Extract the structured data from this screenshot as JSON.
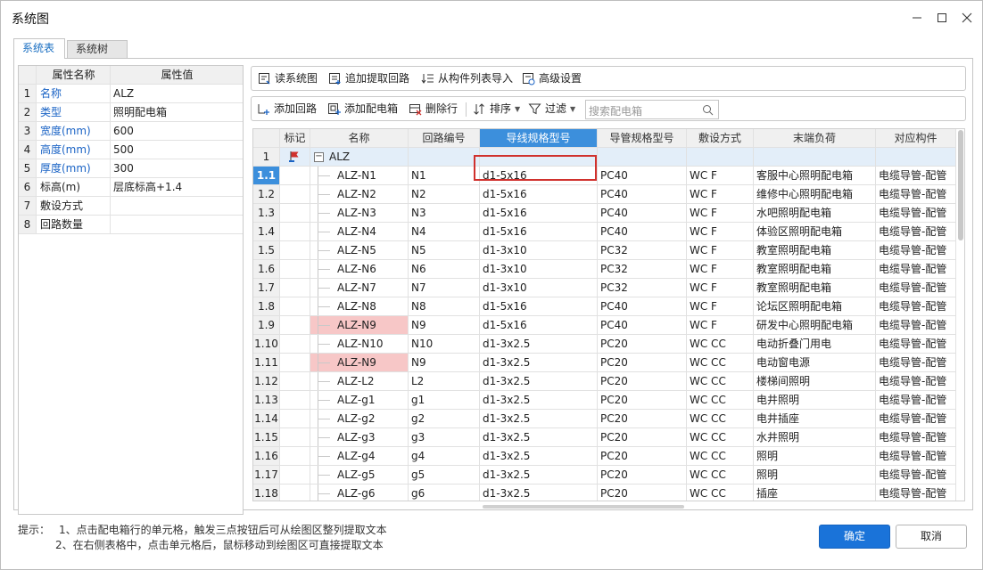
{
  "window": {
    "title": "系统图"
  },
  "tabs": [
    "系统表",
    "系统树"
  ],
  "left": {
    "headers": [
      "",
      "属性名称",
      "属性值"
    ],
    "rows": [
      {
        "n": "1",
        "name": "名称",
        "value": "ALZ",
        "blue": true
      },
      {
        "n": "2",
        "name": "类型",
        "value": "照明配电箱",
        "blue": true
      },
      {
        "n": "3",
        "name": "宽度(mm)",
        "value": "600",
        "blue": true
      },
      {
        "n": "4",
        "name": "高度(mm)",
        "value": "500",
        "blue": true
      },
      {
        "n": "5",
        "name": "厚度(mm)",
        "value": "300",
        "blue": true
      },
      {
        "n": "6",
        "name": "标高(m)",
        "value": "层底标高+1.4",
        "blue": false
      },
      {
        "n": "7",
        "name": "敷设方式",
        "value": "",
        "blue": false
      },
      {
        "n": "8",
        "name": "回路数量",
        "value": "",
        "blue": false
      }
    ]
  },
  "toolbar1": {
    "read": "读系统图",
    "append": "追加提取回路",
    "import": "从构件列表导入",
    "advanced": "高级设置"
  },
  "toolbar2": {
    "add_loop": "添加回路",
    "add_box": "添加配电箱",
    "delete_row": "删除行",
    "sort": "排序",
    "filter": "过滤",
    "search_placeholder": "搜索配电箱"
  },
  "grid": {
    "headers": [
      "",
      "标记",
      "名称",
      "回路编号",
      "导线规格型号",
      "导管规格型号",
      "敷设方式",
      "末端负荷",
      "对应构件"
    ],
    "parent": {
      "n": "1",
      "name": "ALZ"
    },
    "rows": [
      {
        "n": "1.1",
        "name": "ALZ-N1",
        "loop": "N1",
        "wire": "d1-5x16",
        "pipe": "PC40",
        "lay": "WC F",
        "load": "客服中心照明配电箱",
        "comp": "电缆导管-配管",
        "pink": false
      },
      {
        "n": "1.2",
        "name": "ALZ-N2",
        "loop": "N2",
        "wire": "d1-5x16",
        "pipe": "PC40",
        "lay": "WC F",
        "load": "维修中心照明配电箱",
        "comp": "电缆导管-配管",
        "pink": false
      },
      {
        "n": "1.3",
        "name": "ALZ-N3",
        "loop": "N3",
        "wire": "d1-5x16",
        "pipe": "PC40",
        "lay": "WC F",
        "load": "水吧照明配电箱",
        "comp": "电缆导管-配管",
        "pink": false
      },
      {
        "n": "1.4",
        "name": "ALZ-N4",
        "loop": "N4",
        "wire": "d1-5x16",
        "pipe": "PC40",
        "lay": "WC F",
        "load": "体验区照明配电箱",
        "comp": "电缆导管-配管",
        "pink": false
      },
      {
        "n": "1.5",
        "name": "ALZ-N5",
        "loop": "N5",
        "wire": "d1-3x10",
        "pipe": "PC32",
        "lay": "WC F",
        "load": "教室照明配电箱",
        "comp": "电缆导管-配管",
        "pink": false
      },
      {
        "n": "1.6",
        "name": "ALZ-N6",
        "loop": "N6",
        "wire": "d1-3x10",
        "pipe": "PC32",
        "lay": "WC F",
        "load": "教室照明配电箱",
        "comp": "电缆导管-配管",
        "pink": false
      },
      {
        "n": "1.7",
        "name": "ALZ-N7",
        "loop": "N7",
        "wire": "d1-3x10",
        "pipe": "PC32",
        "lay": "WC F",
        "load": "教室照明配电箱",
        "comp": "电缆导管-配管",
        "pink": false
      },
      {
        "n": "1.8",
        "name": "ALZ-N8",
        "loop": "N8",
        "wire": "d1-5x16",
        "pipe": "PC40",
        "lay": "WC F",
        "load": "论坛区照明配电箱",
        "comp": "电缆导管-配管",
        "pink": false
      },
      {
        "n": "1.9",
        "name": "ALZ-N9",
        "loop": "N9",
        "wire": "d1-5x16",
        "pipe": "PC40",
        "lay": "WC F",
        "load": "研发中心照明配电箱",
        "comp": "电缆导管-配管",
        "pink": true
      },
      {
        "n": "1.10",
        "name": "ALZ-N10",
        "loop": "N10",
        "wire": "d1-3x2.5",
        "pipe": "PC20",
        "lay": "WC CC",
        "load": "电动折叠门用电",
        "comp": "电缆导管-配管",
        "pink": false
      },
      {
        "n": "1.11",
        "name": "ALZ-N9",
        "loop": "N9",
        "wire": "d1-3x2.5",
        "pipe": "PC20",
        "lay": "WC CC",
        "load": "电动窗电源",
        "comp": "电缆导管-配管",
        "pink": true
      },
      {
        "n": "1.12",
        "name": "ALZ-L2",
        "loop": "L2",
        "wire": "d1-3x2.5",
        "pipe": "PC20",
        "lay": "WC CC",
        "load": "楼梯间照明",
        "comp": "电缆导管-配管",
        "pink": false
      },
      {
        "n": "1.13",
        "name": "ALZ-g1",
        "loop": "g1",
        "wire": "d1-3x2.5",
        "pipe": "PC20",
        "lay": "WC CC",
        "load": "电井照明",
        "comp": "电缆导管-配管",
        "pink": false
      },
      {
        "n": "1.14",
        "name": "ALZ-g2",
        "loop": "g2",
        "wire": "d1-3x2.5",
        "pipe": "PC20",
        "lay": "WC CC",
        "load": "电井插座",
        "comp": "电缆导管-配管",
        "pink": false
      },
      {
        "n": "1.15",
        "name": "ALZ-g3",
        "loop": "g3",
        "wire": "d1-3x2.5",
        "pipe": "PC20",
        "lay": "WC CC",
        "load": "水井照明",
        "comp": "电缆导管-配管",
        "pink": false
      },
      {
        "n": "1.16",
        "name": "ALZ-g4",
        "loop": "g4",
        "wire": "d1-3x2.5",
        "pipe": "PC20",
        "lay": "WC CC",
        "load": "照明",
        "comp": "电缆导管-配管",
        "pink": false
      },
      {
        "n": "1.17",
        "name": "ALZ-g5",
        "loop": "g5",
        "wire": "d1-3x2.5",
        "pipe": "PC20",
        "lay": "WC CC",
        "load": "照明",
        "comp": "电缆导管-配管",
        "pink": false
      },
      {
        "n": "1.18",
        "name": "ALZ-g6",
        "loop": "g6",
        "wire": "d1-3x2.5",
        "pipe": "PC20",
        "lay": "WC CC",
        "load": "插座",
        "comp": "电缆导管-配管",
        "pink": false
      }
    ]
  },
  "hint": {
    "label": "提示：",
    "line1": "1、点击配电箱行的单元格，触发三点按钮后可从绘图区整列提取文本",
    "line2": "2、在右侧表格中，点击单元格后，鼠标移动到绘图区可直接提取文本"
  },
  "buttons": {
    "ok": "确定",
    "cancel": "取消"
  },
  "colors": {
    "accent": "#1a73d9",
    "header_selected": "#3c8fdc",
    "highlight_row": "#f7c7c7",
    "selection_box": "#d0312d",
    "link_blue": "#1a63c5"
  }
}
